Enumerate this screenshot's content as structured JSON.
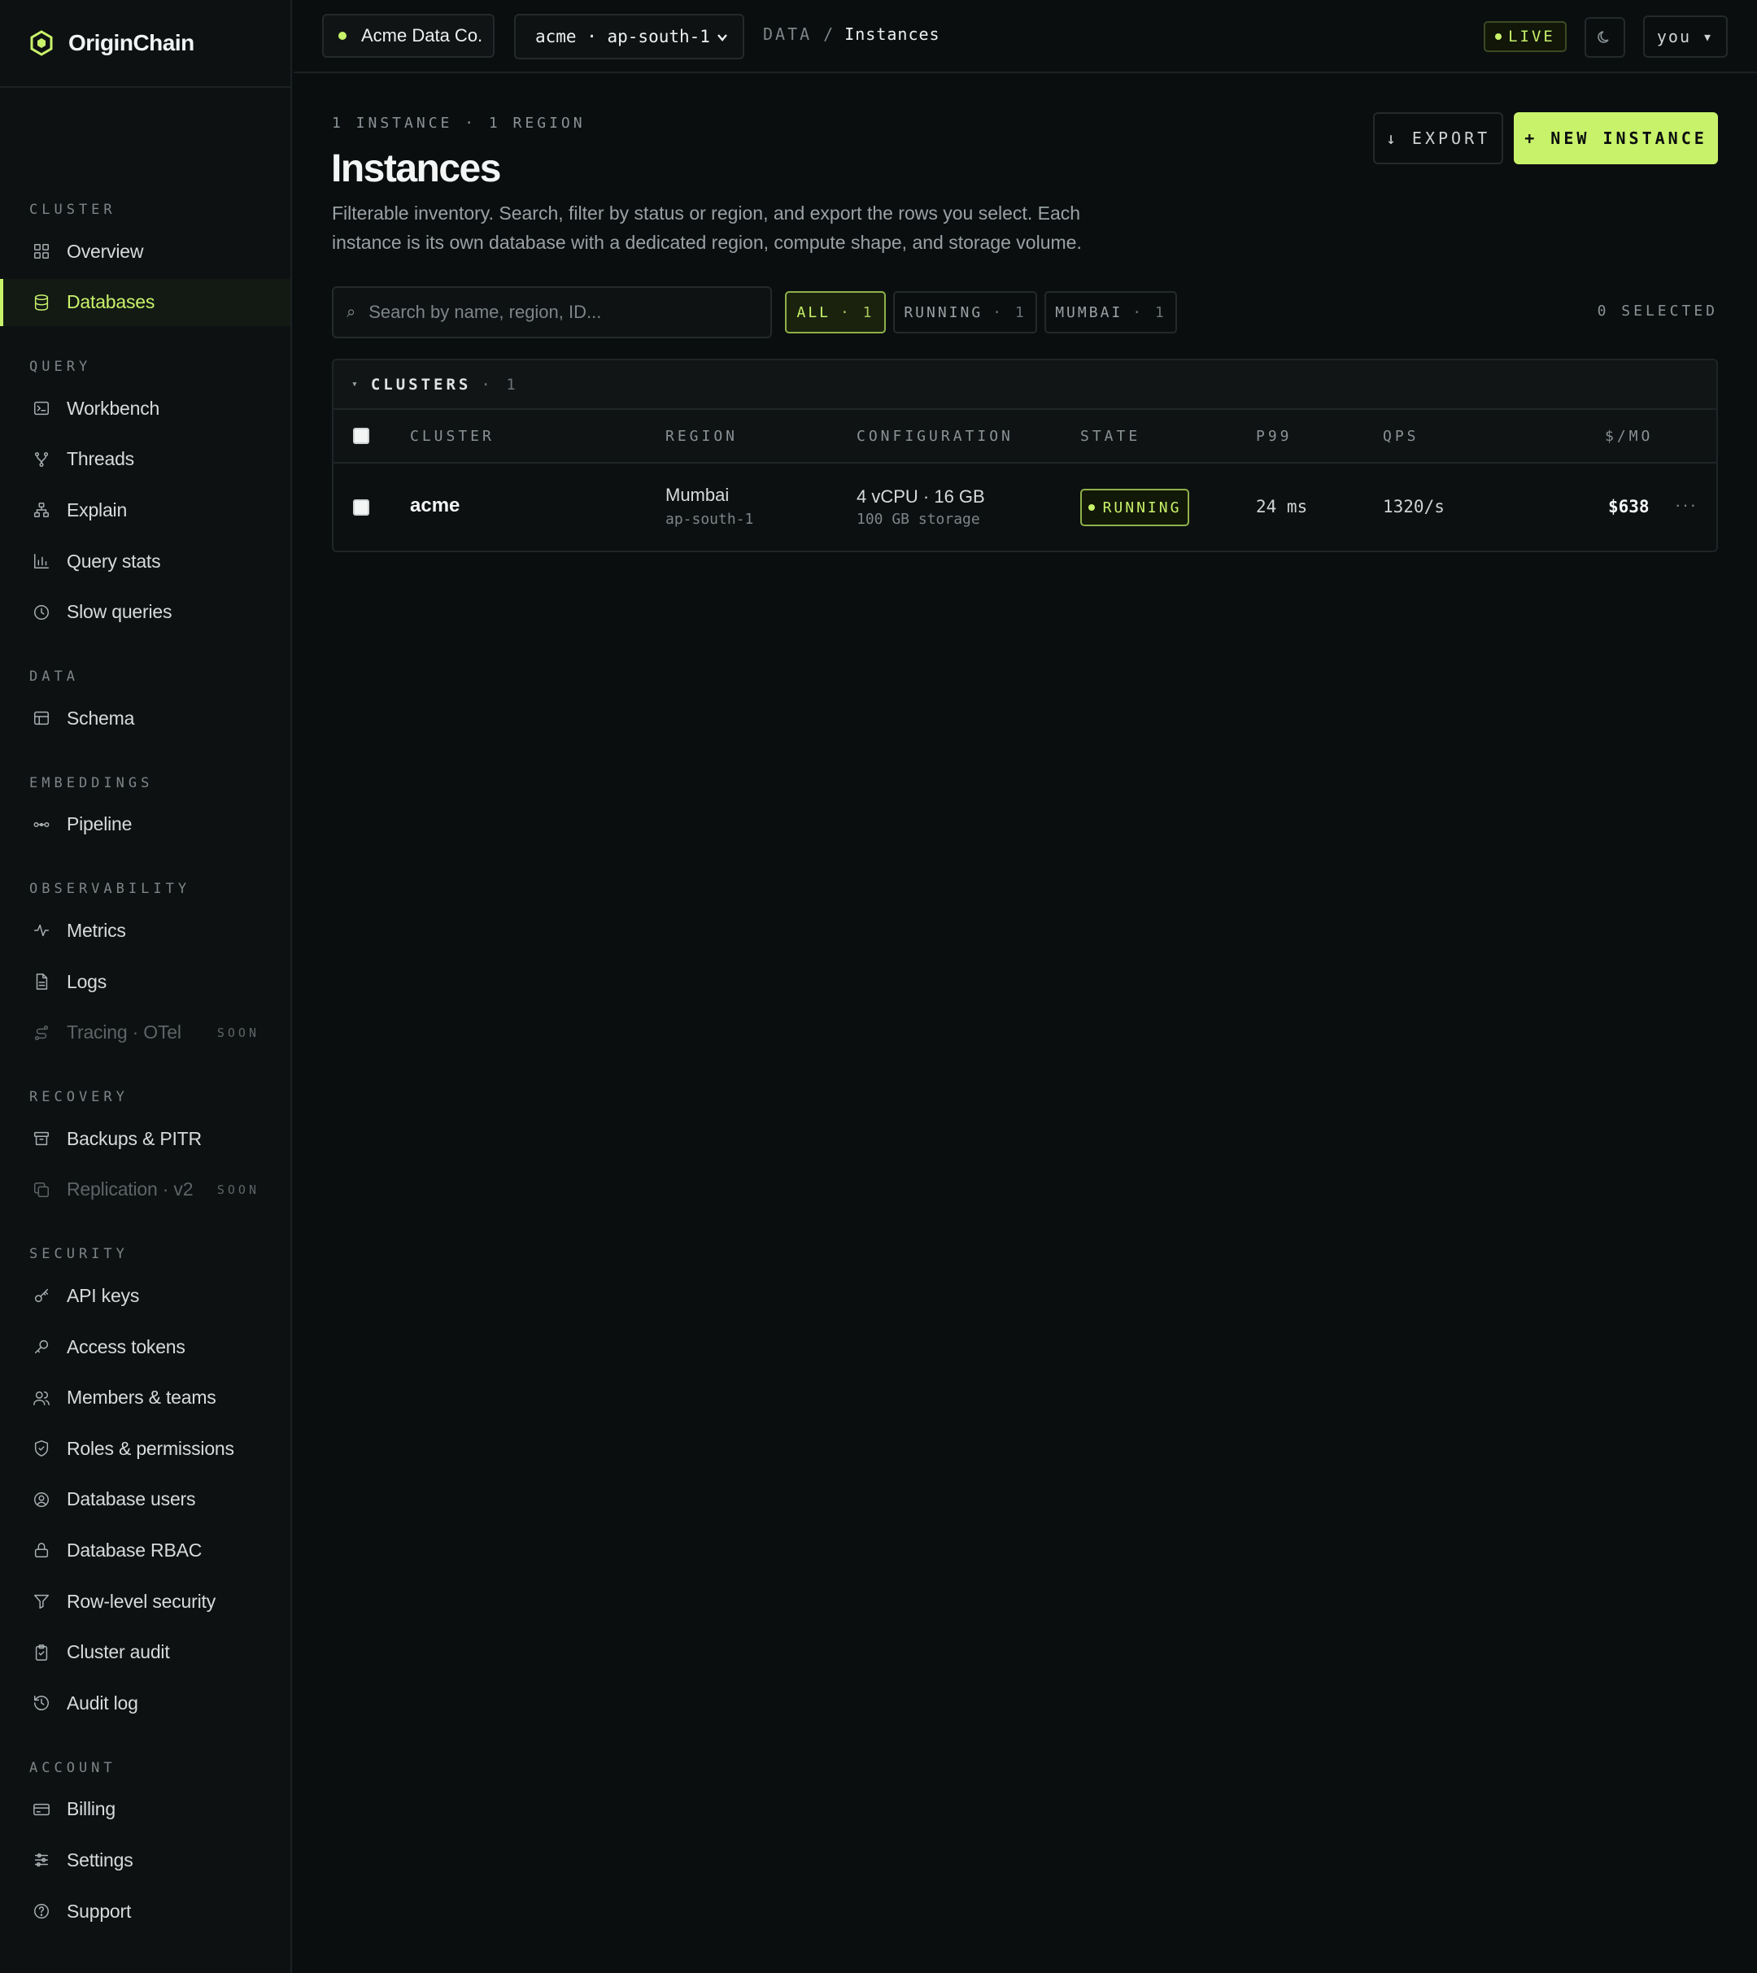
{
  "brand": {
    "name": "OriginChain"
  },
  "sidebar": {
    "sections": [
      {
        "label": "CLUSTER",
        "items": [
          {
            "label": "Overview",
            "icon": "grid-icon"
          },
          {
            "label": "Databases",
            "icon": "database-icon",
            "active": true
          }
        ]
      },
      {
        "label": "QUERY",
        "items": [
          {
            "label": "Workbench",
            "icon": "terminal-icon"
          },
          {
            "label": "Threads",
            "icon": "branch-icon"
          },
          {
            "label": "Explain",
            "icon": "tree-icon"
          },
          {
            "label": "Query stats",
            "icon": "bar-chart-icon"
          },
          {
            "label": "Slow queries",
            "icon": "clock-icon"
          }
        ]
      },
      {
        "label": "DATA",
        "items": [
          {
            "label": "Schema",
            "icon": "table-icon"
          }
        ]
      },
      {
        "label": "EMBEDDINGS",
        "items": [
          {
            "label": "Pipeline",
            "icon": "pipeline-icon"
          }
        ]
      },
      {
        "label": "OBSERVABILITY",
        "items": [
          {
            "label": "Metrics",
            "icon": "activity-icon"
          },
          {
            "label": "Logs",
            "icon": "file-icon"
          },
          {
            "label": "Tracing · OTel",
            "icon": "route-icon",
            "soon": "SOON"
          }
        ]
      },
      {
        "label": "RECOVERY",
        "items": [
          {
            "label": "Backups & PITR",
            "icon": "archive-icon"
          },
          {
            "label": "Replication · v2",
            "icon": "copy-icon",
            "soon": "SOON"
          }
        ]
      },
      {
        "label": "SECURITY",
        "items": [
          {
            "label": "API keys",
            "icon": "key-icon"
          },
          {
            "label": "Access tokens",
            "icon": "token-icon"
          },
          {
            "label": "Members & teams",
            "icon": "users-icon"
          },
          {
            "label": "Roles & permissions",
            "icon": "shield-icon"
          },
          {
            "label": "Database users",
            "icon": "user-circle-icon"
          },
          {
            "label": "Database RBAC",
            "icon": "lock-icon"
          },
          {
            "label": "Row-level security",
            "icon": "filter-icon"
          },
          {
            "label": "Cluster audit",
            "icon": "clipboard-icon"
          },
          {
            "label": "Audit log",
            "icon": "history-icon"
          }
        ]
      },
      {
        "label": "ACCOUNT",
        "items": [
          {
            "label": "Billing",
            "icon": "card-icon"
          },
          {
            "label": "Settings",
            "icon": "sliders-icon"
          },
          {
            "label": "Support",
            "icon": "help-icon"
          }
        ]
      }
    ]
  },
  "topbar": {
    "org": "Acme Data Co.",
    "env_select": "acme · ap-south-1",
    "crumb_section": "DATA",
    "crumb_sep": "/",
    "crumb_page": "Instances",
    "live": "LIVE",
    "user": "you ▾"
  },
  "page": {
    "meta": "1 INSTANCE · 1 REGION",
    "title": "Instances",
    "description": "Filterable inventory. Search, filter by status or region, and export the rows you select. Each instance is its own database with a dedicated region, compute shape, and storage volume.",
    "export_label": "↓ EXPORT",
    "new_label": "+ NEW INSTANCE",
    "search_placeholder": "Search by name, region, ID...",
    "filters": [
      {
        "label": "ALL",
        "count": "· 1",
        "active": true
      },
      {
        "label": "RUNNING",
        "count": "· 1"
      },
      {
        "label": "MUMBAI",
        "count": "· 1"
      }
    ],
    "selected": "0 SELECTED"
  },
  "table": {
    "group": {
      "caret": "▾",
      "name": "CLUSTERS",
      "count": "· 1"
    },
    "columns": [
      "CLUSTER",
      "REGION",
      "CONFIGURATION",
      "STATE",
      "P99",
      "QPS",
      "$/MO"
    ],
    "rows": [
      {
        "cluster": "acme",
        "region": "Mumbai",
        "region_code": "ap-south-1",
        "config": "4 vCPU · 16 GB",
        "storage": "100 GB storage",
        "state": "RUNNING",
        "p99": "24 ms",
        "qps": "1320/s",
        "cost": "$638",
        "more": "···"
      }
    ]
  },
  "colors": {
    "accent": "#c8f26a",
    "bg": "#0b0e0f",
    "sidebar": "#0e1112"
  }
}
